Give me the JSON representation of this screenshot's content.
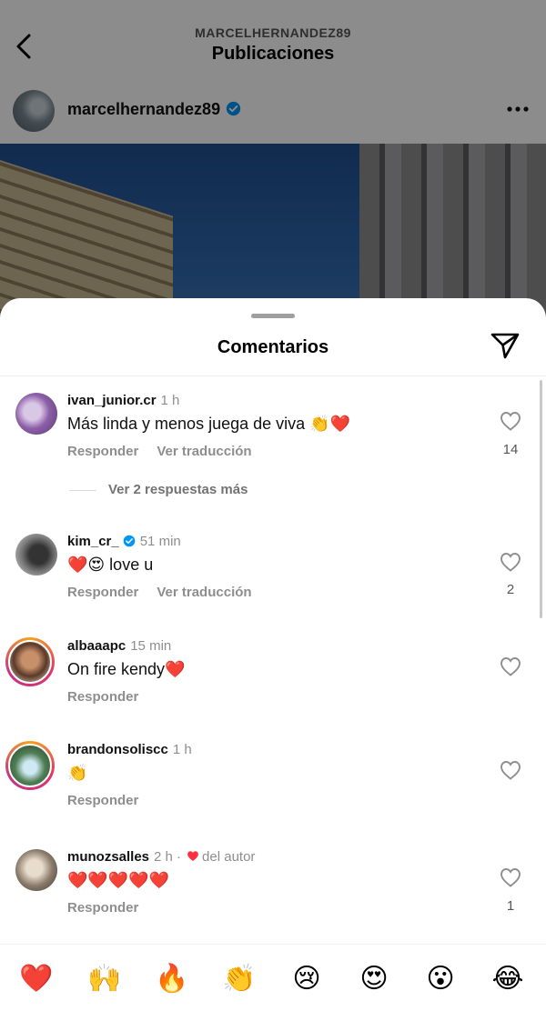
{
  "header": {
    "username_caps": "MARCELHERNANDEZ89",
    "title": "Publicaciones",
    "back_icon": "chevron-left-icon"
  },
  "post": {
    "username": "marcelhernandez89",
    "verified": true,
    "more_icon": "ellipsis-icon"
  },
  "sheet": {
    "title": "Comentarios",
    "share_icon": "paper-plane-icon"
  },
  "comments": [
    {
      "user": "ivan_junior.cr",
      "time": "1 h",
      "text": "Más linda y menos juega de viva 👏❤️",
      "reply": "Responder",
      "translate": "Ver traducción",
      "likes": "14",
      "more_replies": "Ver 2 respuestas más"
    },
    {
      "user": "kim_cr_",
      "verified": true,
      "time": "51 min",
      "text": "❤️😍 love u",
      "reply": "Responder",
      "translate": "Ver traducción",
      "likes": "2"
    },
    {
      "user": "albaaapc",
      "time": "15 min",
      "text": "On fire kendy❤️",
      "reply": "Responder"
    },
    {
      "user": "brandonsoliscc",
      "time": "1 h",
      "text": "👏",
      "reply": "Responder"
    },
    {
      "user": "munozsalles",
      "time": "2 h ·",
      "author_like": "del autor",
      "text": "❤️❤️❤️❤️❤️",
      "reply": "Responder",
      "likes": "1"
    }
  ],
  "emoji_bar": [
    "❤️",
    "🙌",
    "🔥",
    "👏",
    "😢",
    "😍",
    "😮",
    "😂"
  ],
  "colors": {
    "verified_blue": "#0095f6",
    "heart_red": "#ff3040",
    "muted": "#8e8e8e"
  }
}
